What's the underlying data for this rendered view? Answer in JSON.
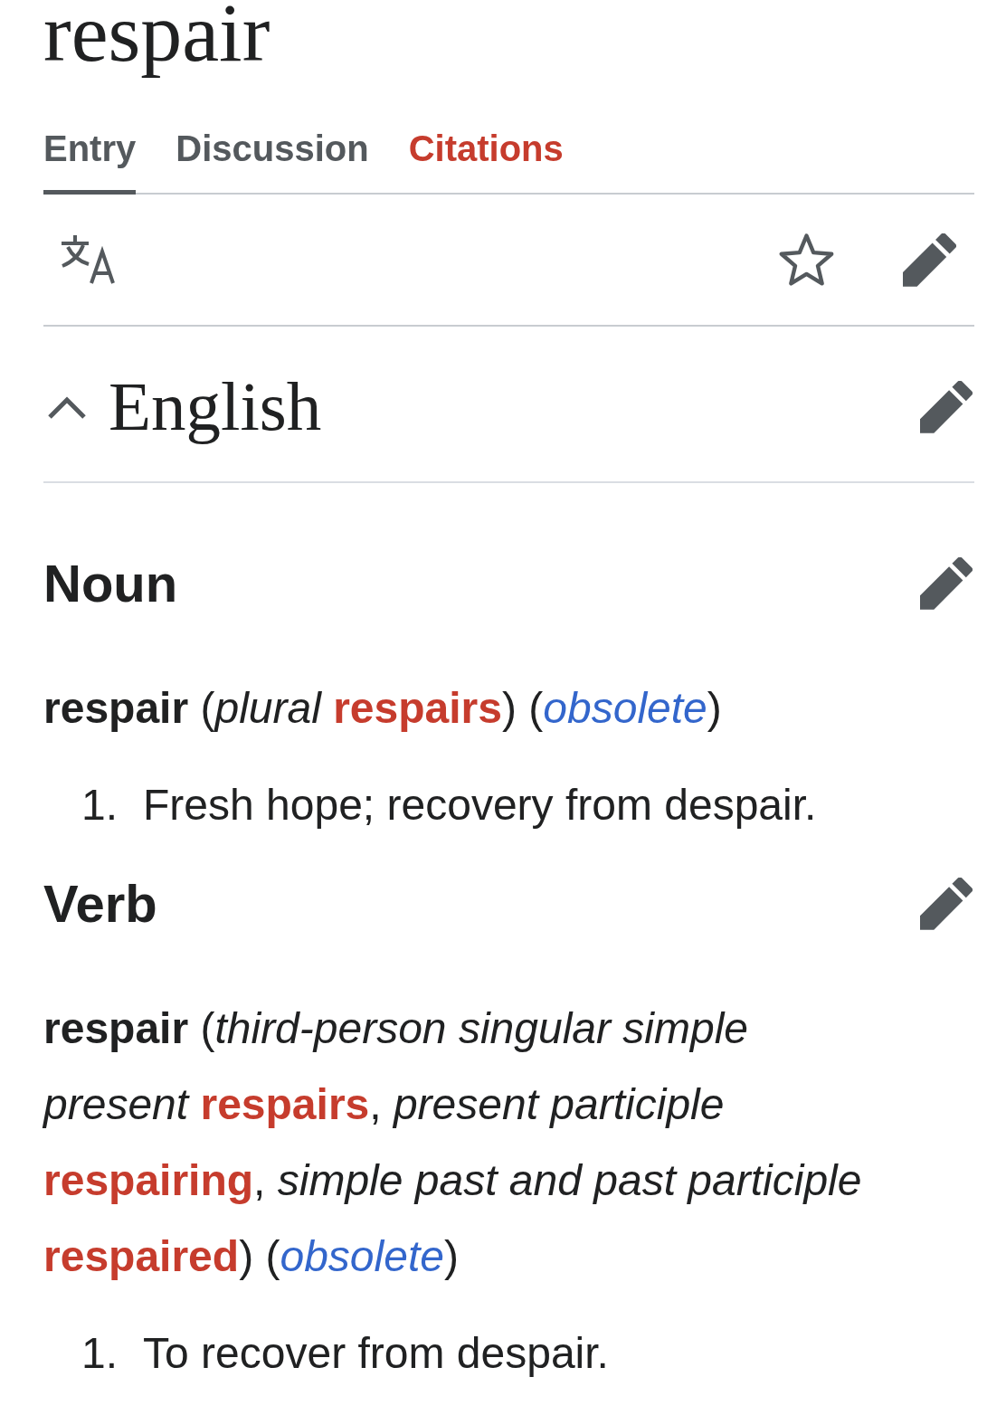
{
  "page_title": "respair",
  "tabs": [
    {
      "label": "Entry",
      "selected": true,
      "color": "#54595d"
    },
    {
      "label": "Discussion",
      "selected": false,
      "color": "#54595d"
    },
    {
      "label": "Citations",
      "selected": false,
      "color": "#c63c2d"
    }
  ],
  "toolbar": {
    "watched": false
  },
  "language_section": {
    "heading": "English",
    "expanded": true
  },
  "parts_of_speech": [
    {
      "heading": "Noun",
      "headword_line": [
        {
          "kind": "text",
          "text": "**respair** (*plural* "
        },
        {
          "kind": "form",
          "text": "respairs"
        },
        {
          "kind": "text",
          "text": ") ("
        },
        {
          "kind": "label",
          "text": "obsolete"
        },
        {
          "kind": "text",
          "text": ")"
        }
      ],
      "definitions": [
        {
          "number": "1.",
          "text": "Fresh hope; recovery from despair."
        }
      ]
    },
    {
      "heading": "Verb",
      "headword_line": [
        {
          "kind": "text",
          "text": "**respair** (*third-person singular simple present* "
        },
        {
          "kind": "form",
          "text": "respairs"
        },
        {
          "kind": "text",
          "text": ", *present participle* "
        },
        {
          "kind": "form",
          "text": "respairing"
        },
        {
          "kind": "text",
          "text": ", *simple past and past participle* "
        },
        {
          "kind": "form",
          "text": "respaired"
        },
        {
          "kind": "text",
          "text": ") ("
        },
        {
          "kind": "label",
          "text": "obsolete"
        },
        {
          "kind": "text",
          "text": ")"
        }
      ],
      "definitions": [
        {
          "number": "1.",
          "text": "To recover from despair."
        }
      ]
    }
  ]
}
